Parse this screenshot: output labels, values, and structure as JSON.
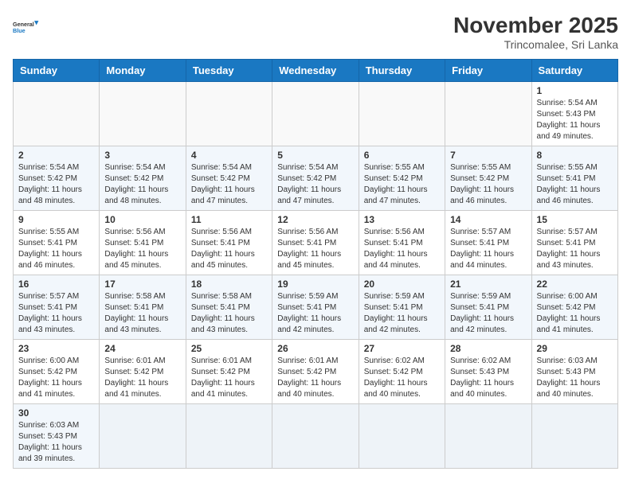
{
  "header": {
    "logo_general": "General",
    "logo_blue": "Blue",
    "title": "November 2025",
    "subtitle": "Trincomalee, Sri Lanka"
  },
  "weekdays": [
    "Sunday",
    "Monday",
    "Tuesday",
    "Wednesday",
    "Thursday",
    "Friday",
    "Saturday"
  ],
  "weeks": [
    [
      {
        "day": "",
        "info": ""
      },
      {
        "day": "",
        "info": ""
      },
      {
        "day": "",
        "info": ""
      },
      {
        "day": "",
        "info": ""
      },
      {
        "day": "",
        "info": ""
      },
      {
        "day": "",
        "info": ""
      },
      {
        "day": "1",
        "info": "Sunrise: 5:54 AM\nSunset: 5:43 PM\nDaylight: 11 hours\nand 49 minutes."
      }
    ],
    [
      {
        "day": "2",
        "info": "Sunrise: 5:54 AM\nSunset: 5:42 PM\nDaylight: 11 hours\nand 48 minutes."
      },
      {
        "day": "3",
        "info": "Sunrise: 5:54 AM\nSunset: 5:42 PM\nDaylight: 11 hours\nand 48 minutes."
      },
      {
        "day": "4",
        "info": "Sunrise: 5:54 AM\nSunset: 5:42 PM\nDaylight: 11 hours\nand 47 minutes."
      },
      {
        "day": "5",
        "info": "Sunrise: 5:54 AM\nSunset: 5:42 PM\nDaylight: 11 hours\nand 47 minutes."
      },
      {
        "day": "6",
        "info": "Sunrise: 5:55 AM\nSunset: 5:42 PM\nDaylight: 11 hours\nand 47 minutes."
      },
      {
        "day": "7",
        "info": "Sunrise: 5:55 AM\nSunset: 5:42 PM\nDaylight: 11 hours\nand 46 minutes."
      },
      {
        "day": "8",
        "info": "Sunrise: 5:55 AM\nSunset: 5:41 PM\nDaylight: 11 hours\nand 46 minutes."
      }
    ],
    [
      {
        "day": "9",
        "info": "Sunrise: 5:55 AM\nSunset: 5:41 PM\nDaylight: 11 hours\nand 46 minutes."
      },
      {
        "day": "10",
        "info": "Sunrise: 5:56 AM\nSunset: 5:41 PM\nDaylight: 11 hours\nand 45 minutes."
      },
      {
        "day": "11",
        "info": "Sunrise: 5:56 AM\nSunset: 5:41 PM\nDaylight: 11 hours\nand 45 minutes."
      },
      {
        "day": "12",
        "info": "Sunrise: 5:56 AM\nSunset: 5:41 PM\nDaylight: 11 hours\nand 45 minutes."
      },
      {
        "day": "13",
        "info": "Sunrise: 5:56 AM\nSunset: 5:41 PM\nDaylight: 11 hours\nand 44 minutes."
      },
      {
        "day": "14",
        "info": "Sunrise: 5:57 AM\nSunset: 5:41 PM\nDaylight: 11 hours\nand 44 minutes."
      },
      {
        "day": "15",
        "info": "Sunrise: 5:57 AM\nSunset: 5:41 PM\nDaylight: 11 hours\nand 43 minutes."
      }
    ],
    [
      {
        "day": "16",
        "info": "Sunrise: 5:57 AM\nSunset: 5:41 PM\nDaylight: 11 hours\nand 43 minutes."
      },
      {
        "day": "17",
        "info": "Sunrise: 5:58 AM\nSunset: 5:41 PM\nDaylight: 11 hours\nand 43 minutes."
      },
      {
        "day": "18",
        "info": "Sunrise: 5:58 AM\nSunset: 5:41 PM\nDaylight: 11 hours\nand 43 minutes."
      },
      {
        "day": "19",
        "info": "Sunrise: 5:59 AM\nSunset: 5:41 PM\nDaylight: 11 hours\nand 42 minutes."
      },
      {
        "day": "20",
        "info": "Sunrise: 5:59 AM\nSunset: 5:41 PM\nDaylight: 11 hours\nand 42 minutes."
      },
      {
        "day": "21",
        "info": "Sunrise: 5:59 AM\nSunset: 5:41 PM\nDaylight: 11 hours\nand 42 minutes."
      },
      {
        "day": "22",
        "info": "Sunrise: 6:00 AM\nSunset: 5:42 PM\nDaylight: 11 hours\nand 41 minutes."
      }
    ],
    [
      {
        "day": "23",
        "info": "Sunrise: 6:00 AM\nSunset: 5:42 PM\nDaylight: 11 hours\nand 41 minutes."
      },
      {
        "day": "24",
        "info": "Sunrise: 6:01 AM\nSunset: 5:42 PM\nDaylight: 11 hours\nand 41 minutes."
      },
      {
        "day": "25",
        "info": "Sunrise: 6:01 AM\nSunset: 5:42 PM\nDaylight: 11 hours\nand 41 minutes."
      },
      {
        "day": "26",
        "info": "Sunrise: 6:01 AM\nSunset: 5:42 PM\nDaylight: 11 hours\nand 40 minutes."
      },
      {
        "day": "27",
        "info": "Sunrise: 6:02 AM\nSunset: 5:42 PM\nDaylight: 11 hours\nand 40 minutes."
      },
      {
        "day": "28",
        "info": "Sunrise: 6:02 AM\nSunset: 5:43 PM\nDaylight: 11 hours\nand 40 minutes."
      },
      {
        "day": "29",
        "info": "Sunrise: 6:03 AM\nSunset: 5:43 PM\nDaylight: 11 hours\nand 40 minutes."
      }
    ],
    [
      {
        "day": "30",
        "info": "Sunrise: 6:03 AM\nSunset: 5:43 PM\nDaylight: 11 hours\nand 39 minutes."
      },
      {
        "day": "",
        "info": ""
      },
      {
        "day": "",
        "info": ""
      },
      {
        "day": "",
        "info": ""
      },
      {
        "day": "",
        "info": ""
      },
      {
        "day": "",
        "info": ""
      },
      {
        "day": "",
        "info": ""
      }
    ]
  ]
}
